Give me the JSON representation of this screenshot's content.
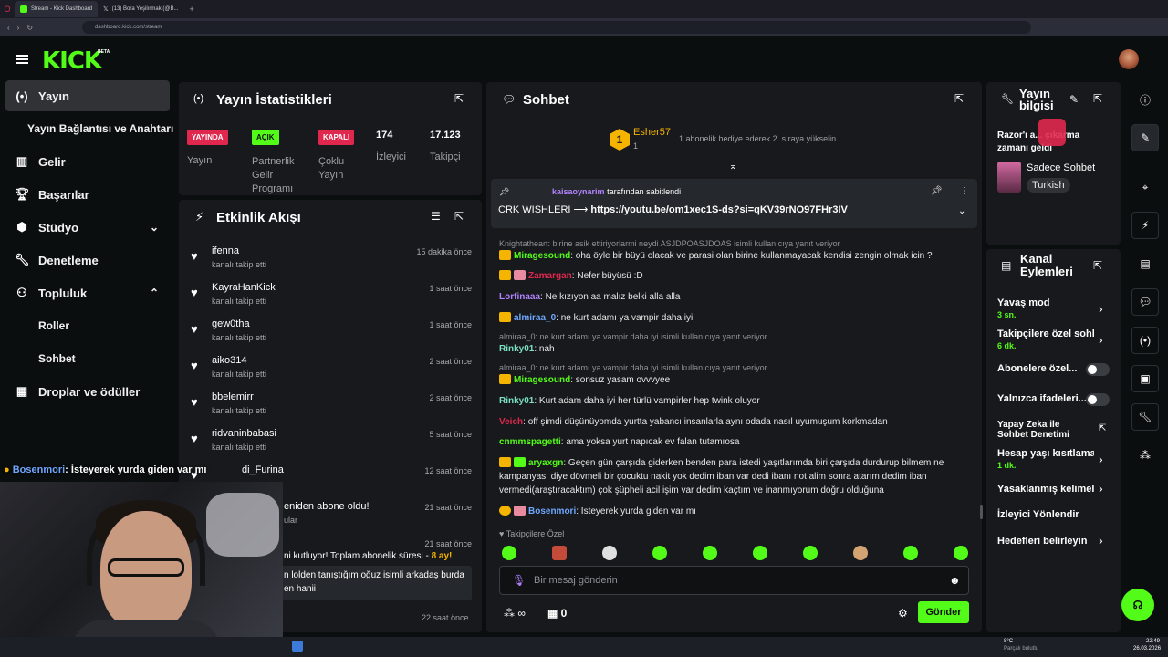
{
  "browser": {
    "tabs": [
      "Stream - Kick Dashboard",
      "(13) Bora Yeşilırmak (@B..."
    ],
    "url": "dashboard.kick.com/stream"
  },
  "header": {
    "logo": "KICK",
    "beta": "BETA"
  },
  "nav": [
    {
      "label": "Yayın",
      "icon": "broadcast-icon"
    },
    {
      "label": "Yayın Bağlantısı ve Anahtarı",
      "icon": ""
    },
    {
      "label": "Gelir",
      "icon": "revenue-icon"
    },
    {
      "label": "Başarılar",
      "icon": "trophy-icon"
    },
    {
      "label": "Stüdyo",
      "icon": "studio-icon"
    },
    {
      "label": "Denetleme",
      "icon": "wrench-icon"
    },
    {
      "label": "Topluluk",
      "icon": "community-icon"
    },
    {
      "label": "Roller",
      "icon": ""
    },
    {
      "label": "Sohbet",
      "icon": ""
    },
    {
      "label": "Droplar ve ödüller",
      "icon": "drops-icon"
    }
  ],
  "stats": {
    "title": "Yayın İstatistikleri",
    "live_badge": "YAYINDA",
    "live_label": "Yayın",
    "partner_badge": "AÇIK",
    "partner_label": "Partnerlik Gelir Programı",
    "multi_badge": "KAPALI",
    "multi_label": "Çoklu Yayın",
    "viewers": "174",
    "viewers_label": "İzleyici",
    "followers": "17.123",
    "followers_label": "Takipçi"
  },
  "activity": {
    "title": "Etkinlik Akışı",
    "items": [
      {
        "name": "ifenna",
        "sub": "kanalı takip etti",
        "time": "15 dakika önce"
      },
      {
        "name": "KayraHanKick",
        "sub": "kanalı takip etti",
        "time": "1 saat önce"
      },
      {
        "name": "gew0tha",
        "sub": "kanalı takip etti",
        "time": "1 saat önce"
      },
      {
        "name": "aiko314",
        "sub": "kanalı takip etti",
        "time": "2 saat önce"
      },
      {
        "name": "bbelemirr",
        "sub": "kanalı takip etti",
        "time": "2 saat önce"
      },
      {
        "name": "ridvaninbabasi",
        "sub": "kanalı takip etti",
        "time": "5 saat önce"
      },
      {
        "name": "di_Furina",
        "sub": "",
        "time": "12 saat önce"
      },
      {
        "name": "eniden abone oldu!",
        "sub": "ular",
        "time": "21 saat önce"
      },
      {
        "name": "",
        "sub": "",
        "time": "21 saat önce"
      }
    ],
    "sub_text": "ni kutluyor! Toplam abonelik süresi - ",
    "sub_months": "8 ay!",
    "gift_line1": "n lolden tanıştığım oğuz isimli arkadaş burda",
    "gift_line2": "en hanii",
    "last_time": "22 saat önce"
  },
  "chat": {
    "title": "Sohbet",
    "gifter": "Esher57",
    "gifter_count": "1",
    "gifter_rank": "1",
    "gift_note": "1 abonelik hediye ederek 2. sıraya yükselin",
    "pinned_by": "kaisaoynarim",
    "pinned_label": "tarafından sabitlendi",
    "pinned_text": "CRK WISHLERI ⟶ ",
    "pinned_link": "https://youtu.be/om1xec1S-ds?si=qKV39rNO97FHr3IV",
    "messages": [
      {
        "reply": "Knightatheart: birine asik ettiriyorlarmi neydi ASJDPOASJDOAS isimli kullanıcıya yanıt veriyor"
      },
      {
        "user": "Miragesound",
        "color": "#53fc18",
        "text": "oha öyle bir büyü olacak ve parasi olan birine kullanmayacak kendisi zengin olmak icin ?"
      },
      {
        "user": "Zamargan",
        "color": "#e0284f",
        "text": "Nefer büyüsü :D"
      },
      {
        "user": "Lorfinaaa",
        "color": "#b383ff",
        "text": "Ne kızıyon aa malız belki alla alla"
      },
      {
        "user": "almiraa_0",
        "color": "#6fa8ff",
        "text": "ne kurt adamı ya vampir daha iyi"
      },
      {
        "reply": "almiraa_0: ne kurt adamı ya vampir daha iyi isimli kullanıcıya yanıt veriyor"
      },
      {
        "user": "Rinky01",
        "color": "#7ce0c3",
        "text": "nah"
      },
      {
        "reply": "almiraa_0: ne kurt adamı ya vampir daha iyi isimli kullanıcıya yanıt veriyor"
      },
      {
        "user": "Miragesound",
        "color": "#53fc18",
        "text": "sonsuz yasam ovvvyee"
      },
      {
        "user": "Rinky01",
        "color": "#7ce0c3",
        "text": "Kurt adam daha iyi her türlü vampirler hep twink oluyor"
      },
      {
        "user": "Veich",
        "color": "#e0284f",
        "text": "off şimdi düşünüyomda yurtta yabancı insanlarla aynı odada nasıl uyumuşum korkmadan"
      },
      {
        "user": "cnmmspagetti",
        "color": "#53fc18",
        "text": "ama yoksa yurt napıcak ev falan tutamıosa"
      },
      {
        "user": "aryaxgn",
        "color": "#53fc18",
        "text": "Geçen gün çarşıda giderken benden para istedi yaşıtlarımda biri çarşıda durdurup bilmem ne kampanyası diye dövmeli bir çocuktu nakit yok dedim iban var dedi ibanı not alim sonra atarım dedim iban vermedi(araştıracaktım) çok şüpheli acil işim var dedim kaçtım ve inanmıyorum doğru olduğuna"
      },
      {
        "user": "Bosenmori",
        "color": "#6fa8ff",
        "text": "İsteyerek yurda giden var mı"
      }
    ],
    "followers_only": "Takipçilere Özel",
    "input_placeholder": "Bir mesaj gönderin",
    "points": "∞",
    "gifts": "0",
    "send": "Gönder"
  },
  "info": {
    "title": "Yayın bilgisi",
    "line": "Razor'ı a... çıkarma zamanı geldi",
    "category": "Sadece Sohbet",
    "tag": "Turkish"
  },
  "actions": {
    "title": "Kanal Eylemleri",
    "items": [
      {
        "label": "Yavaş mod",
        "sub": "3 sn.",
        "kind": "chev"
      },
      {
        "label": "Takipçilere özel sohb",
        "sub": "6 dk.",
        "kind": "chev"
      },
      {
        "label": "Abonelere özel...",
        "sub": "",
        "kind": "toggle"
      },
      {
        "label": "Yalnızca ifadeleri...",
        "sub": "",
        "kind": "toggle"
      },
      {
        "label": "Yapay Zeka ile Sohbet Denetimi",
        "sub": "",
        "kind": "ext"
      },
      {
        "label": "Hesap yaşı kısıtlama",
        "sub": "1 dk.",
        "kind": "chev"
      },
      {
        "label": "Yasaklanmış kelimele",
        "sub": "",
        "kind": "chev"
      },
      {
        "label": "İzleyici Yönlendir",
        "sub": "",
        "kind": "none"
      },
      {
        "label": "Hedefleri belirleyin",
        "sub": "",
        "kind": "chev"
      }
    ]
  },
  "overlay": {
    "user": "Bosenmori",
    "text": " İsteyerek yurda giden var mı"
  },
  "taskbar": {
    "weather": "8°C",
    "weather_sub": "Parçalı bulutlu",
    "time": "22:49",
    "date": "26.03.2026"
  },
  "colors": {
    "accent": "#53fc18",
    "live": "#e0284f",
    "bg": "#0b0e0f",
    "panel": "#17191c"
  }
}
